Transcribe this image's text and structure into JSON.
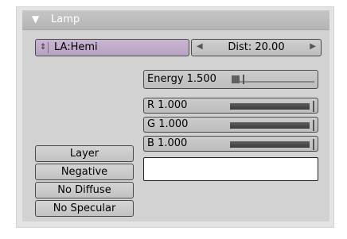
{
  "panel": {
    "title": "Lamp",
    "collapse_icon": "triangle-down-icon"
  },
  "lamp_selector": {
    "value": "LA:Hemi",
    "icon": "updown-arrows-icon"
  },
  "dist": {
    "label": "Dist: 20.00",
    "left_icon": "arrow-left-icon",
    "right_icon": "arrow-right-icon"
  },
  "energy": {
    "label": "Energy 1.500",
    "fraction": 0.15
  },
  "color": {
    "r": {
      "label": "R 1.000",
      "value": 1.0
    },
    "g": {
      "label": "G 1.000",
      "value": 1.0
    },
    "b": {
      "label": "B 1.000",
      "value": 1.0
    },
    "swatch": "#ffffff"
  },
  "toggles": [
    "Layer",
    "Negative",
    "No Diffuse",
    "No Specular"
  ]
}
